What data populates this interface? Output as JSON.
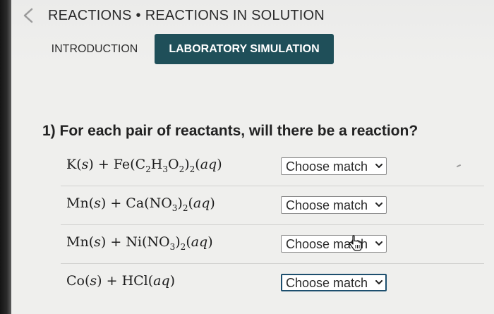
{
  "header": {
    "breadcrumb_section": "REACTIONS",
    "breadcrumb_separator": "•",
    "breadcrumb_page": "REACTIONS IN SOLUTION",
    "back_icon": "chevron-left-icon"
  },
  "tabs": [
    {
      "label": "INTRODUCTION",
      "active": false
    },
    {
      "label": "LABORATORY SIMULATION",
      "active": true
    }
  ],
  "colors": {
    "active_tab": "#1f4f59",
    "focus_border": "#1d4f6e"
  },
  "question": {
    "text": "1) For each pair of reactants, will there be a reaction?",
    "rows": [
      {
        "select_value": "Choose match",
        "focused": false
      },
      {
        "select_value": "Choose match",
        "focused": false
      },
      {
        "select_value": "Choose match",
        "focused": false
      },
      {
        "select_value": "Choose match",
        "focused": true
      }
    ]
  }
}
